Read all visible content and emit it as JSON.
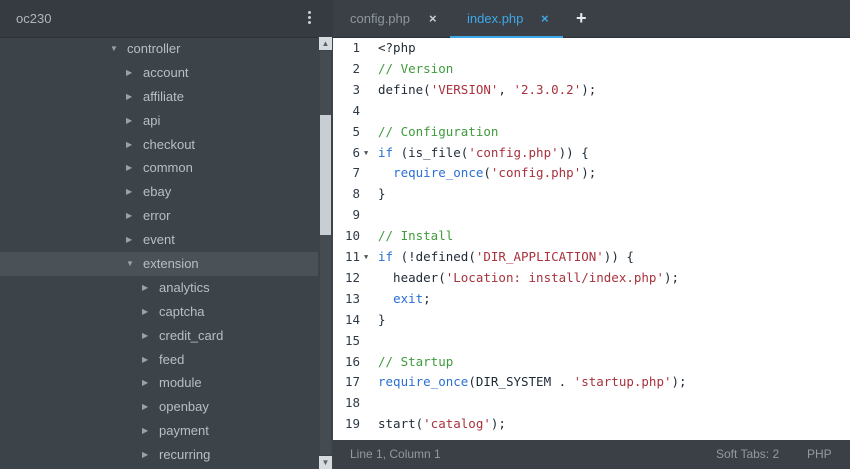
{
  "sidebar": {
    "project": "oc230",
    "tree": [
      {
        "label": "controller",
        "depth": 0,
        "expanded": true,
        "selected": false
      },
      {
        "label": "account",
        "depth": 1,
        "expanded": false,
        "selected": false
      },
      {
        "label": "affiliate",
        "depth": 1,
        "expanded": false,
        "selected": false
      },
      {
        "label": "api",
        "depth": 1,
        "expanded": false,
        "selected": false
      },
      {
        "label": "checkout",
        "depth": 1,
        "expanded": false,
        "selected": false
      },
      {
        "label": "common",
        "depth": 1,
        "expanded": false,
        "selected": false
      },
      {
        "label": "ebay",
        "depth": 1,
        "expanded": false,
        "selected": false
      },
      {
        "label": "error",
        "depth": 1,
        "expanded": false,
        "selected": false
      },
      {
        "label": "event",
        "depth": 1,
        "expanded": false,
        "selected": false
      },
      {
        "label": "extension",
        "depth": 1,
        "expanded": true,
        "selected": true
      },
      {
        "label": "analytics",
        "depth": 2,
        "expanded": false,
        "selected": false
      },
      {
        "label": "captcha",
        "depth": 2,
        "expanded": false,
        "selected": false
      },
      {
        "label": "credit_card",
        "depth": 2,
        "expanded": false,
        "selected": false
      },
      {
        "label": "feed",
        "depth": 2,
        "expanded": false,
        "selected": false
      },
      {
        "label": "module",
        "depth": 2,
        "expanded": false,
        "selected": false
      },
      {
        "label": "openbay",
        "depth": 2,
        "expanded": false,
        "selected": false
      },
      {
        "label": "payment",
        "depth": 2,
        "expanded": false,
        "selected": false
      },
      {
        "label": "recurring",
        "depth": 2,
        "expanded": false,
        "selected": false
      }
    ]
  },
  "tabs": [
    {
      "label": "config.php",
      "close": "×",
      "active": false
    },
    {
      "label": "index.php",
      "close": "×",
      "active": true
    }
  ],
  "new_tab": "+",
  "editor": {
    "lines": [
      {
        "n": "1",
        "fold": false,
        "tokens": [
          {
            "t": "<?php",
            "c": "plain"
          }
        ]
      },
      {
        "n": "2",
        "fold": false,
        "tokens": [
          {
            "t": "// Version",
            "c": "cmt"
          }
        ]
      },
      {
        "n": "3",
        "fold": false,
        "tokens": [
          {
            "t": "define(",
            "c": "plain"
          },
          {
            "t": "'VERSION'",
            "c": "str"
          },
          {
            "t": ", ",
            "c": "plain"
          },
          {
            "t": "'2.3.0.2'",
            "c": "str"
          },
          {
            "t": ");",
            "c": "plain"
          }
        ]
      },
      {
        "n": "4",
        "fold": false,
        "tokens": []
      },
      {
        "n": "5",
        "fold": false,
        "tokens": [
          {
            "t": "// Configuration",
            "c": "cmt"
          }
        ]
      },
      {
        "n": "6",
        "fold": true,
        "tokens": [
          {
            "t": "if",
            "c": "kw"
          },
          {
            "t": " (is_file(",
            "c": "plain"
          },
          {
            "t": "'config.php'",
            "c": "str"
          },
          {
            "t": ")) {",
            "c": "plain"
          }
        ]
      },
      {
        "n": "7",
        "fold": false,
        "tokens": [
          {
            "t": "  ",
            "c": "plain"
          },
          {
            "t": "require_once",
            "c": "kw"
          },
          {
            "t": "(",
            "c": "plain"
          },
          {
            "t": "'config.php'",
            "c": "str"
          },
          {
            "t": ");",
            "c": "plain"
          }
        ]
      },
      {
        "n": "8",
        "fold": false,
        "tokens": [
          {
            "t": "}",
            "c": "plain"
          }
        ]
      },
      {
        "n": "9",
        "fold": false,
        "tokens": []
      },
      {
        "n": "10",
        "fold": false,
        "tokens": [
          {
            "t": "// Install",
            "c": "cmt"
          }
        ]
      },
      {
        "n": "11",
        "fold": true,
        "tokens": [
          {
            "t": "if",
            "c": "kw"
          },
          {
            "t": " (!defined(",
            "c": "plain"
          },
          {
            "t": "'DIR_APPLICATION'",
            "c": "str"
          },
          {
            "t": ")) {",
            "c": "plain"
          }
        ]
      },
      {
        "n": "12",
        "fold": false,
        "tokens": [
          {
            "t": "  header(",
            "c": "plain"
          },
          {
            "t": "'Location: install/index.php'",
            "c": "str"
          },
          {
            "t": ");",
            "c": "plain"
          }
        ]
      },
      {
        "n": "13",
        "fold": false,
        "tokens": [
          {
            "t": "  ",
            "c": "plain"
          },
          {
            "t": "exit",
            "c": "kw"
          },
          {
            "t": ";",
            "c": "plain"
          }
        ]
      },
      {
        "n": "14",
        "fold": false,
        "tokens": [
          {
            "t": "}",
            "c": "plain"
          }
        ]
      },
      {
        "n": "15",
        "fold": false,
        "tokens": []
      },
      {
        "n": "16",
        "fold": false,
        "tokens": [
          {
            "t": "// Startup",
            "c": "cmt"
          }
        ]
      },
      {
        "n": "17",
        "fold": false,
        "tokens": [
          {
            "t": "require_once",
            "c": "kw"
          },
          {
            "t": "(DIR_SYSTEM . ",
            "c": "plain"
          },
          {
            "t": "'startup.php'",
            "c": "str"
          },
          {
            "t": ");",
            "c": "plain"
          }
        ]
      },
      {
        "n": "18",
        "fold": false,
        "tokens": []
      },
      {
        "n": "19",
        "fold": false,
        "tokens": [
          {
            "t": "start(",
            "c": "plain"
          },
          {
            "t": "'catalog'",
            "c": "str"
          },
          {
            "t": ");",
            "c": "plain"
          }
        ]
      }
    ]
  },
  "status": {
    "position": "Line 1, Column 1",
    "tabs": "Soft Tabs: 2",
    "language": "PHP"
  },
  "icons": {
    "menu": "vertical-dots",
    "caret_collapsed": "▶",
    "caret_expanded": "▼",
    "fold": "▼",
    "scroll_up": "▲",
    "scroll_down": "▼"
  }
}
